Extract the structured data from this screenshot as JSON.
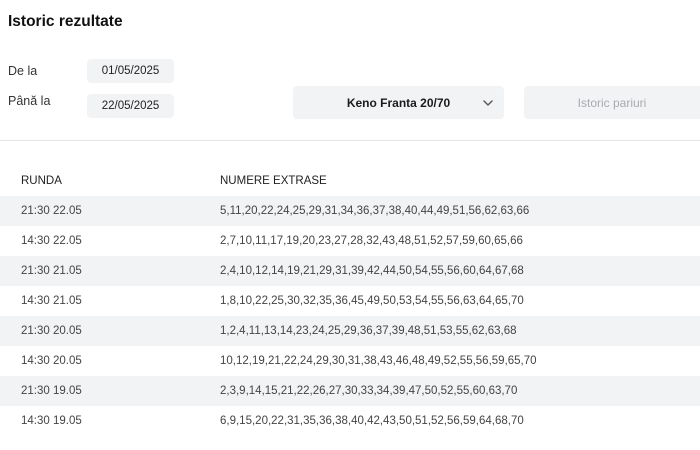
{
  "header": {
    "title": "Istoric rezultate"
  },
  "filters": {
    "from_label": "De la",
    "from_value": "01/05/2025",
    "to_label": "Până la",
    "to_value": "22/05/2025",
    "game_select": "Keno Franta 20/70",
    "history_button": "Istoric pariuri"
  },
  "table": {
    "columns": [
      "RUNDA",
      "NUMERE EXTRASE"
    ],
    "rows": [
      {
        "round": "21:30 22.05",
        "numbers": "5,11,20,22,24,25,29,31,34,36,37,38,40,44,49,51,56,62,63,66"
      },
      {
        "round": "14:30 22.05",
        "numbers": "2,7,10,11,17,19,20,23,27,28,32,43,48,51,52,57,59,60,65,66"
      },
      {
        "round": "21:30 21.05",
        "numbers": "2,4,10,12,14,19,21,29,31,39,42,44,50,54,55,56,60,64,67,68"
      },
      {
        "round": "14:30 21.05",
        "numbers": "1,8,10,22,25,30,32,35,36,45,49,50,53,54,55,56,63,64,65,70"
      },
      {
        "round": "21:30 20.05",
        "numbers": "1,2,4,11,13,14,23,24,25,29,36,37,39,48,51,53,55,62,63,68"
      },
      {
        "round": "14:30 20.05",
        "numbers": "10,12,19,21,22,24,29,30,31,38,43,46,48,49,52,55,56,59,65,70"
      },
      {
        "round": "21:30 19.05",
        "numbers": "2,3,9,14,15,21,22,26,27,30,33,34,39,47,50,52,55,60,63,70"
      },
      {
        "round": "14:30 19.05",
        "numbers": "6,9,15,20,22,31,35,36,38,40,42,43,50,51,52,56,59,64,68,70"
      }
    ]
  },
  "icons": {
    "dropdown": "chevron-down-icon"
  }
}
